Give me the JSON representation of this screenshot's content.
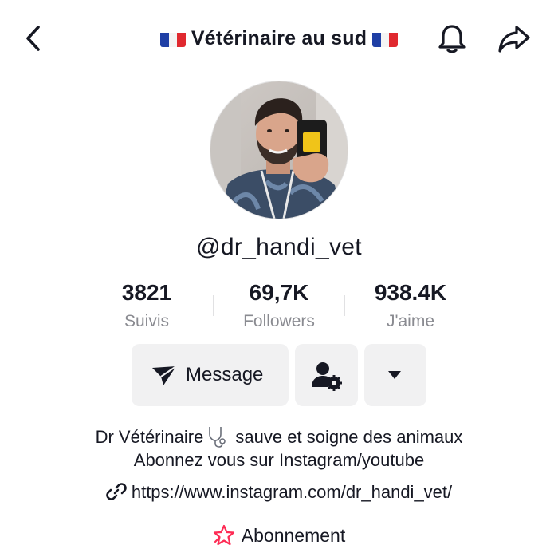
{
  "header": {
    "title": "Vétérinaire au sud",
    "flag_icon": "france-flag-icon",
    "back_icon": "chevron-left-icon",
    "notification_icon": "bell-icon",
    "share_icon": "share-arrow-icon"
  },
  "profile": {
    "avatar_icon": "profile-photo",
    "username": "@dr_handi_vet"
  },
  "stats": [
    {
      "value": "3821",
      "label": "Suivis"
    },
    {
      "value": "69,7K",
      "label": "Followers"
    },
    {
      "value": "938.4K",
      "label": "J'aime"
    }
  ],
  "actions": {
    "message_label": "Message",
    "message_icon": "send-plane-icon",
    "friend_icon": "user-settings-icon",
    "more_icon": "caret-down-icon"
  },
  "bio": {
    "line1_before": "Dr Vétérinaire",
    "line1_icon": "stethoscope-icon",
    "line1_after": " sauve et soigne des animaux",
    "line2": "Abonnez vous sur Instagram/youtube"
  },
  "link": {
    "url": "https://www.instagram.com/dr_handi_vet/",
    "icon": "link-icon"
  },
  "subscription": {
    "label": "Abonnement",
    "icon": "star-badge-icon"
  },
  "colors": {
    "text": "#161823",
    "secondary_text": "#8a8b91",
    "button_bg": "#f1f1f2",
    "accent_pink": "#fe2c55"
  }
}
